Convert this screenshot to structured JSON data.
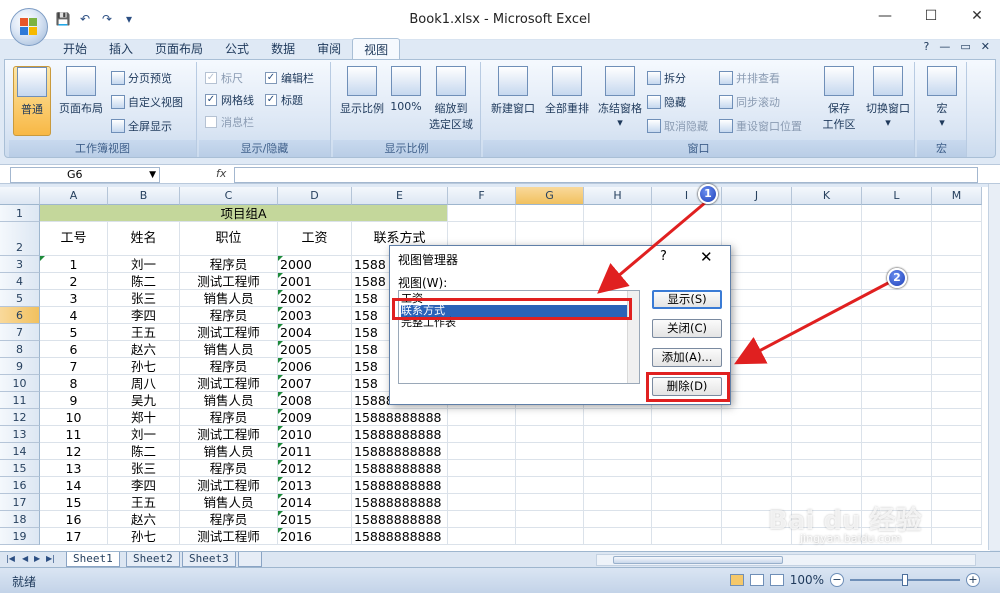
{
  "window": {
    "title": "Book1.xlsx - Microsoft Excel",
    "minimize": "—",
    "maximize": "☐",
    "close": "✕"
  },
  "qat": {
    "save": "💾",
    "undo": "↶",
    "redo": "↷",
    "more": "▾"
  },
  "tabs": [
    "开始",
    "插入",
    "页面布局",
    "公式",
    "数据",
    "审阅",
    "视图"
  ],
  "tab_active_index": 6,
  "tab_right": {
    "help": "?",
    "min": "—",
    "restore": "▭",
    "close": "✕"
  },
  "ribbon": {
    "g1": {
      "label": "工作簿视图",
      "normal": "普通",
      "page_layout": "页面布局",
      "page_break": "分页预览",
      "custom_view": "自定义视图",
      "full_screen": "全屏显示"
    },
    "g2": {
      "label": "显示/隐藏",
      "ruler": "标尺",
      "gridlines": "网格线",
      "message_bar": "消息栏",
      "formula_bar": "编辑栏",
      "headings": "标题"
    },
    "g3": {
      "label": "显示比例",
      "zoom": "显示比例",
      "zoom100": "100%",
      "zoom_sel_1": "缩放到",
      "zoom_sel_2": "选定区域"
    },
    "g4": {
      "label": "窗口",
      "new_window": "新建窗口",
      "arrange_all": "全部重排",
      "freeze": "冻结窗格",
      "split": "拆分",
      "hide": "隐藏",
      "unhide": "取消隐藏",
      "side_by_side": "并排查看",
      "sync_scroll": "同步滚动",
      "reset_pos": "重设窗口位置",
      "save_ws_1": "保存",
      "save_ws_2": "工作区",
      "switch": "切换窗口"
    },
    "g5": {
      "label": "宏",
      "macro": "宏"
    }
  },
  "formula_bar": {
    "name_box": "G6",
    "fx": "fx"
  },
  "columns": [
    "A",
    "B",
    "C",
    "D",
    "E",
    "F",
    "G",
    "H",
    "I",
    "J",
    "K",
    "L",
    "M"
  ],
  "rows": [
    "1",
    "2",
    "3",
    "4",
    "5",
    "6",
    "7",
    "8",
    "9",
    "10",
    "11",
    "12",
    "13",
    "14",
    "15",
    "16",
    "17",
    "18",
    "19"
  ],
  "sheet": {
    "merged_title": "项目组A",
    "headers": [
      "工号",
      "姓名",
      "职位",
      "工资",
      "联系方式"
    ],
    "data": [
      [
        "1",
        "刘一",
        "程序员",
        "2000",
        "1588"
      ],
      [
        "2",
        "陈二",
        "测试工程师",
        "2001",
        "1588"
      ],
      [
        "3",
        "张三",
        "销售人员",
        "2002",
        "158"
      ],
      [
        "4",
        "李四",
        "程序员",
        "2003",
        "158"
      ],
      [
        "5",
        "王五",
        "测试工程师",
        "2004",
        "158"
      ],
      [
        "6",
        "赵六",
        "销售人员",
        "2005",
        "158"
      ],
      [
        "7",
        "孙七",
        "程序员",
        "2006",
        "158"
      ],
      [
        "8",
        "周八",
        "测试工程师",
        "2007",
        "158"
      ],
      [
        "9",
        "吴九",
        "销售人员",
        "2008",
        "15888888888"
      ],
      [
        "10",
        "郑十",
        "程序员",
        "2009",
        "15888888888"
      ],
      [
        "11",
        "刘一",
        "测试工程师",
        "2010",
        "15888888888"
      ],
      [
        "12",
        "陈二",
        "销售人员",
        "2011",
        "15888888888"
      ],
      [
        "13",
        "张三",
        "程序员",
        "2012",
        "15888888888"
      ],
      [
        "14",
        "李四",
        "测试工程师",
        "2013",
        "15888888888"
      ],
      [
        "15",
        "王五",
        "销售人员",
        "2014",
        "15888888888"
      ],
      [
        "16",
        "赵六",
        "程序员",
        "2015",
        "15888888888"
      ],
      [
        "17",
        "孙七",
        "测试工程师",
        "2016",
        "15888888888"
      ]
    ]
  },
  "sheet_tabs": [
    "Sheet1",
    "Sheet2",
    "Sheet3"
  ],
  "status": {
    "ready": "就绪",
    "zoom": "100%"
  },
  "dialog": {
    "title": "视图管理器",
    "help": "?",
    "close": "✕",
    "list_label": "视图(W):",
    "items": [
      "工资",
      "联系方式",
      "完整工作表"
    ],
    "selected_index": 1,
    "btn_show": "显示(S)",
    "btn_close": "关闭(C)",
    "btn_add": "添加(A)...",
    "btn_delete": "删除(D)"
  },
  "annotations": {
    "badge1": "1",
    "badge2": "2"
  },
  "watermark": {
    "brand": "Bai du 经验",
    "url": "jingyan.baidu.com"
  }
}
